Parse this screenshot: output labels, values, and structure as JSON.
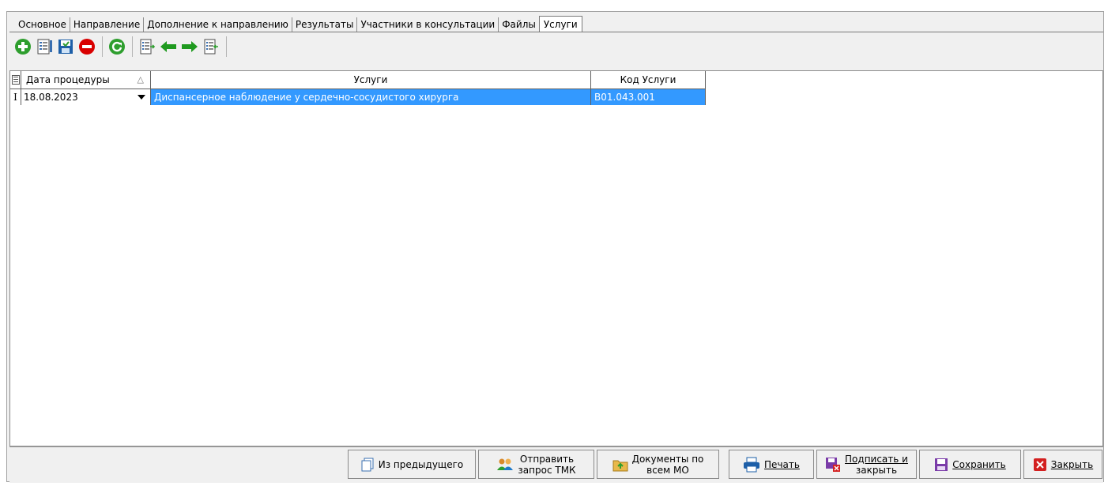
{
  "tabs": [
    {
      "label": "Основное",
      "active": false
    },
    {
      "label": "Направление",
      "active": false
    },
    {
      "label": "Дополнение к направлению",
      "active": false
    },
    {
      "label": "Результаты",
      "active": false
    },
    {
      "label": "Участники в консультации",
      "active": false
    },
    {
      "label": "Файлы",
      "active": false
    },
    {
      "label": "Услуги",
      "active": true
    }
  ],
  "toolbar": {
    "icons": [
      "add-icon",
      "edit-icon",
      "save-icon",
      "delete-icon",
      "refresh-icon",
      "export-icon",
      "arrow-left-icon",
      "arrow-right-icon",
      "import-icon"
    ]
  },
  "grid": {
    "columns": [
      "Дата процедуры",
      "Услуги",
      "Код Услуги"
    ],
    "sort_indicator": "△",
    "rows": [
      {
        "date": "18.08.2023",
        "service": "Диспансерное наблюдение у сердечно-сосудистого хирурга",
        "code": "B01.043.001"
      }
    ]
  },
  "buttons": {
    "from_previous": "Из предыдущего",
    "send_tmk_1": "Отправить",
    "send_tmk_2": "запрос ТМК",
    "docs_1": "Документы по",
    "docs_2": "всем МО",
    "print": "Печать",
    "sign_close_1": "Подписать и",
    "sign_close_2": "закрыть",
    "save": "Сохранить",
    "close": "Закрыть"
  },
  "colors": {
    "selection": "#3399ff",
    "add": "#2e9e2e",
    "delete": "#d90000",
    "refresh": "#2e9e2e",
    "arrow": "#1f9a1f",
    "close": "#d32020",
    "save": "#7a3ba8"
  }
}
